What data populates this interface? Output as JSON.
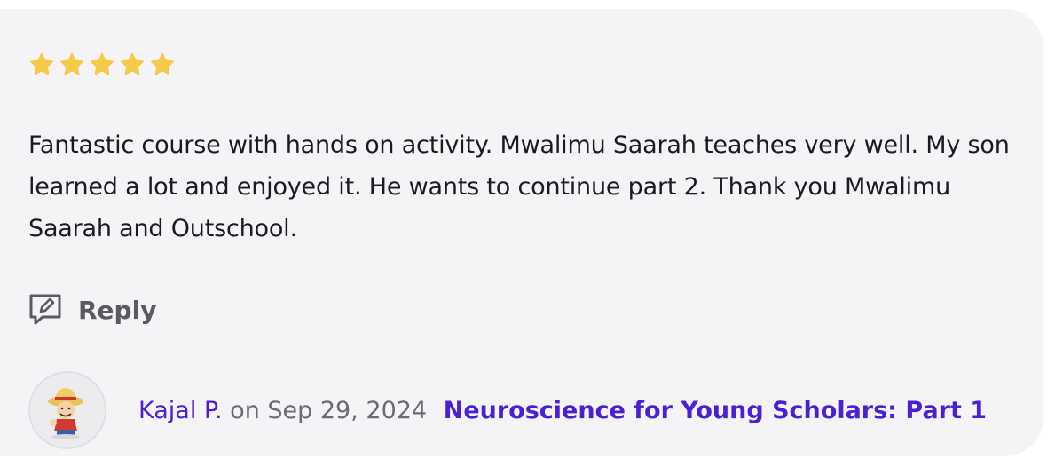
{
  "review": {
    "rating": 5,
    "rating_max": 5,
    "star_icon": "star-icon",
    "star_color": "#f7c948",
    "text": "Fantastic course with hands on activity. Mwalimu Saarah teaches very well. My son learned a lot and enjoyed it. He wants to continue part 2. Thank you Mwalimu Saarah and Outschool.",
    "reply_label": "Reply",
    "reply_icon": "reply-comment-icon",
    "author": "Kajal P.",
    "date_prefix": "on",
    "date": "Sep 29, 2024",
    "course": "Neuroscience for Young Scholars: Part 1",
    "link_color": "#4b1fd4"
  }
}
